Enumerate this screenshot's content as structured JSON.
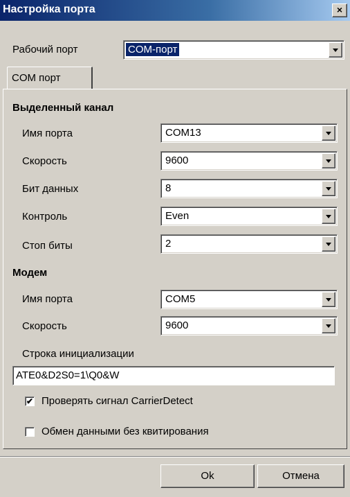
{
  "window": {
    "title": "Настройка порта",
    "close_glyph": "×"
  },
  "work_port": {
    "label": "Рабочий порт",
    "value": "COM-порт"
  },
  "tab": {
    "label": "COM порт"
  },
  "dedicated": {
    "heading": "Выделенный канал",
    "fields": [
      {
        "label": "Имя порта",
        "value": "COM13"
      },
      {
        "label": "Скорость",
        "value": "9600"
      },
      {
        "label": "Бит данных",
        "value": "8"
      },
      {
        "label": "Контроль",
        "value": "Even"
      },
      {
        "label": "Стоп биты",
        "value": "2"
      }
    ]
  },
  "modem": {
    "heading": "Модем",
    "fields": [
      {
        "label": "Имя порта",
        "value": "COM5"
      },
      {
        "label": "Скорость",
        "value": "9600"
      }
    ],
    "init_label": "Строка инициализации",
    "init_value": "ATE0&D2S0=1\\Q0&W",
    "check1_label": "Проверять сигнал CarrierDetect",
    "check1_checked": true,
    "check1_mark": "✔",
    "check2_label": "Обмен данными без квитирования",
    "check2_checked": false
  },
  "buttons": {
    "ok": "Ok",
    "cancel": "Отмена"
  }
}
